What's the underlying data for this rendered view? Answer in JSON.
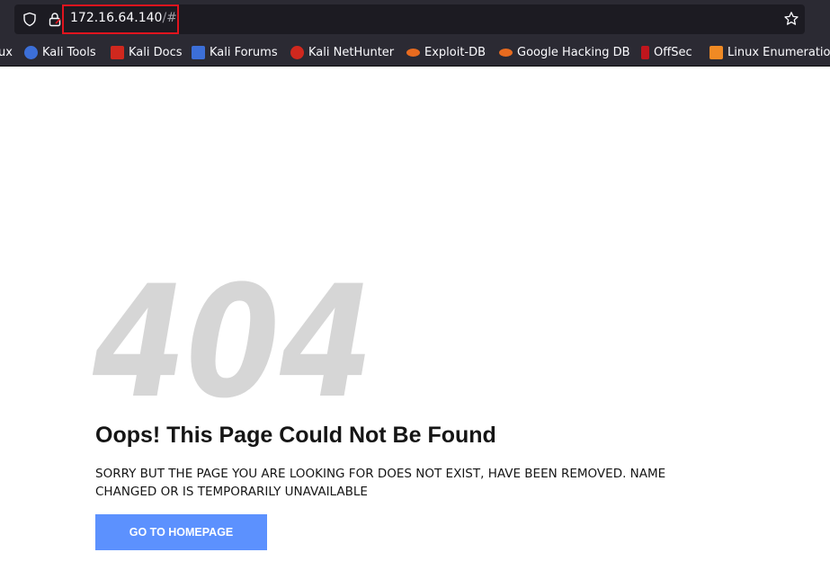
{
  "browser": {
    "url_host": "172.16.64.140",
    "url_path": "/#"
  },
  "bookmarks": [
    {
      "label": "ux",
      "icon": "kali-icon",
      "color": "#2b2a33"
    },
    {
      "label": "Kali Tools",
      "icon": "kali-tools-icon",
      "color": "#3c6fd8"
    },
    {
      "label": "Kali Docs",
      "icon": "kali-docs-icon",
      "color": "#d0281e"
    },
    {
      "label": "Kali Forums",
      "icon": "kali-forums-icon",
      "color": "#3c6fd8"
    },
    {
      "label": "Kali NetHunter",
      "icon": "kali-nethunter-icon",
      "color": "#d0281e"
    },
    {
      "label": "Exploit-DB",
      "icon": "exploit-db-icon",
      "color": "#e86b1f"
    },
    {
      "label": "Google Hacking DB",
      "icon": "ghdb-icon",
      "color": "#e86b1f"
    },
    {
      "label": "OffSec",
      "icon": "offsec-icon",
      "color": "#c0161d"
    },
    {
      "label": "Linux Enumeration",
      "icon": "linux-enum-icon",
      "color": "#f08a24"
    }
  ],
  "page": {
    "error_code": "404",
    "heading": "Oops! This Page Could Not Be Found",
    "message": "SORRY BUT THE PAGE YOU ARE LOOKING FOR DOES NOT EXIST, HAVE BEEN REMOVED. NAME CHANGED OR IS TEMPORARILY UNAVAILABLE",
    "button_label": "GO TO HOMEPAGE"
  },
  "colors": {
    "button": "#5c91fe",
    "highlight": "#e0141e",
    "chrome": "#2b2a33"
  }
}
